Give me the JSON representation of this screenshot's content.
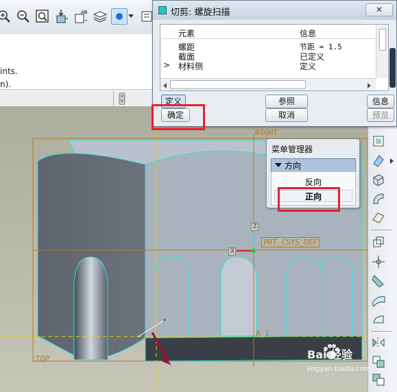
{
  "app": {
    "message_lines": [
      "ints.",
      "n)."
    ]
  },
  "dialog": {
    "title": "切剪: 螺旋扫描",
    "close_symbol": "✕",
    "table": {
      "headers": [
        "元素",
        "信息"
      ],
      "rows": [
        {
          "element": "螺距",
          "info": "节距 = 1.5",
          "marker": ""
        },
        {
          "element": "截面",
          "info": "已定义",
          "marker": ""
        },
        {
          "element": "材料侧",
          "info": "定义",
          "marker": ">"
        }
      ]
    },
    "buttons": {
      "define": "定义",
      "ref": "参照",
      "info": "信息",
      "ok": "确定",
      "cancel": "取消",
      "preview": "预览"
    }
  },
  "menu_manager": {
    "title": "菜单管理器",
    "group": "方向",
    "items": [
      "反向",
      "正向"
    ]
  },
  "viewport": {
    "labels": {
      "right": "RIGHT",
      "top": "TOP",
      "csys": "PRT_CSYS_DEF",
      "axis_x": "X",
      "axis_z": "Z",
      "a1": "A_1"
    }
  },
  "watermark": {
    "brand": "Bai 经验",
    "url": "jingyan.baidu.com"
  },
  "colors": {
    "highlight_red": "#e8202a",
    "model_edge": "#2fe0e0",
    "datum": "#c8901c",
    "dialog_bg": "#e9edf2"
  }
}
